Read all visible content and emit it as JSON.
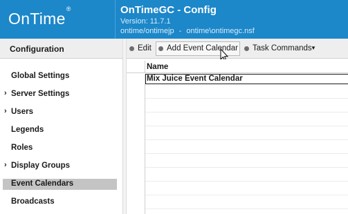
{
  "header": {
    "logo_text": "OnTime",
    "logo_mark": "®",
    "title": "OnTimeGC - Config",
    "version": "Version: 11.7.1",
    "server": "ontime/ontimejp",
    "separator": "-",
    "database": "ontime\\ontimegc.nsf"
  },
  "sidebar": {
    "header": "Configuration",
    "items": [
      {
        "label": "Global Settings",
        "chevron": ""
      },
      {
        "label": "Server Settings",
        "chevron": "›"
      },
      {
        "label": "Users",
        "chevron": "›"
      },
      {
        "label": "Legends",
        "chevron": ""
      },
      {
        "label": "Roles",
        "chevron": ""
      },
      {
        "label": "Display Groups",
        "chevron": "›"
      },
      {
        "label": "Event Calendars",
        "chevron": "",
        "selected": true
      },
      {
        "label": "Broadcasts",
        "chevron": ""
      }
    ]
  },
  "toolbar": {
    "edit_label": "Edit",
    "add_label": "Add Event Calendar",
    "tasks_label": "Task Commands",
    "tasks_caret": "▼"
  },
  "grid": {
    "column_header": "Name",
    "rows": [
      "Mix Juice Event Calendar"
    ]
  },
  "colors": {
    "header_blue": "#1c87c9",
    "selected_nav": "#c4c4c4",
    "toolbar_bg": "#eeeeee"
  }
}
